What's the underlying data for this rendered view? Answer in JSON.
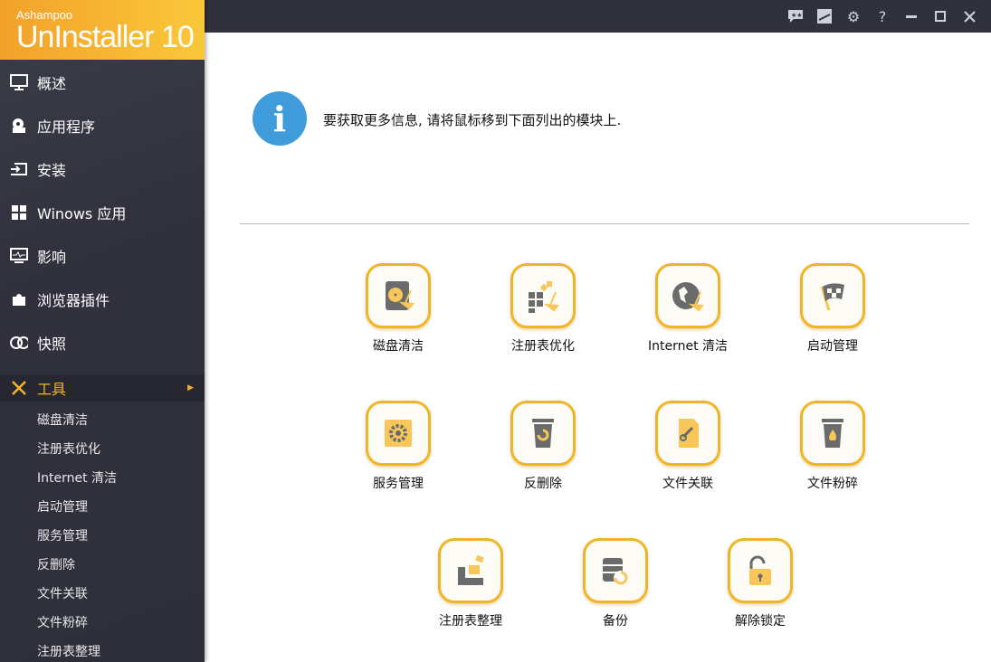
{
  "app": {
    "brand": "Ashampoo",
    "product": "UnInstaller 10"
  },
  "titlebar": {
    "buttons": [
      "feedback-icon",
      "skin-icon",
      "settings-icon",
      "help-icon",
      "minimize-icon",
      "maximize-icon",
      "close-icon"
    ],
    "help": "?"
  },
  "sidebar": {
    "items": [
      {
        "label": "概述",
        "icon": "monitor-icon"
      },
      {
        "label": "应用程序",
        "icon": "apps-icon"
      },
      {
        "label": "安装",
        "icon": "install-icon"
      },
      {
        "label": "Winows 应用",
        "icon": "windows-icon"
      },
      {
        "label": "影响",
        "icon": "impact-icon"
      },
      {
        "label": "浏览器插件",
        "icon": "puzzle-icon"
      },
      {
        "label": "快照",
        "icon": "snapshot-icon"
      },
      {
        "label": "工具",
        "icon": "tools-icon",
        "active": true
      }
    ],
    "subitems": [
      "磁盘清洁",
      "注册表优化",
      "Internet 清洁",
      "启动管理",
      "服务管理",
      "反删除",
      "文件关联",
      "文件粉碎",
      "注册表整理"
    ]
  },
  "main": {
    "info": "要获取更多信息, 请将鼠标移到下面列出的模块上.",
    "tools": [
      {
        "label": "磁盘清洁",
        "icon": "disk-cleaner-icon"
      },
      {
        "label": "注册表优化",
        "icon": "registry-optimizer-icon"
      },
      {
        "label": "Internet 清洁",
        "icon": "internet-cleaner-icon"
      },
      {
        "label": "启动管理",
        "icon": "startup-flag-icon"
      },
      {
        "label": "服务管理",
        "icon": "service-gear-icon"
      },
      {
        "label": "反删除",
        "icon": "undelete-icon"
      },
      {
        "label": "文件关联",
        "icon": "file-link-icon"
      },
      {
        "label": "文件粉碎",
        "icon": "file-shredder-icon"
      },
      {
        "label": "注册表整理",
        "icon": "registry-defrag-icon"
      },
      {
        "label": "备份",
        "icon": "backup-icon"
      },
      {
        "label": "解除锁定",
        "icon": "unlock-icon"
      }
    ]
  },
  "colors": {
    "accent": "#f5b32b",
    "sidebar": "#30313c",
    "info": "#3f9bd9"
  }
}
